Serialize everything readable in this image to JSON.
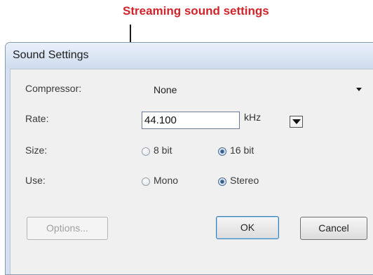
{
  "annotation": {
    "text": "Streaming sound settings"
  },
  "dialog": {
    "title": "Sound Settings",
    "compressor": {
      "label": "Compressor:",
      "value": "None"
    },
    "rate": {
      "label": "Rate:",
      "value": "44.100",
      "unit": "kHz"
    },
    "size": {
      "label": "Size:",
      "options": [
        "8 bit",
        "16 bit"
      ],
      "selected": "16 bit"
    },
    "use": {
      "label": "Use:",
      "options": [
        "Mono",
        "Stereo"
      ],
      "selected": "Stereo"
    },
    "buttons": {
      "options": "Options...",
      "ok": "OK",
      "cancel": "Cancel"
    }
  }
}
